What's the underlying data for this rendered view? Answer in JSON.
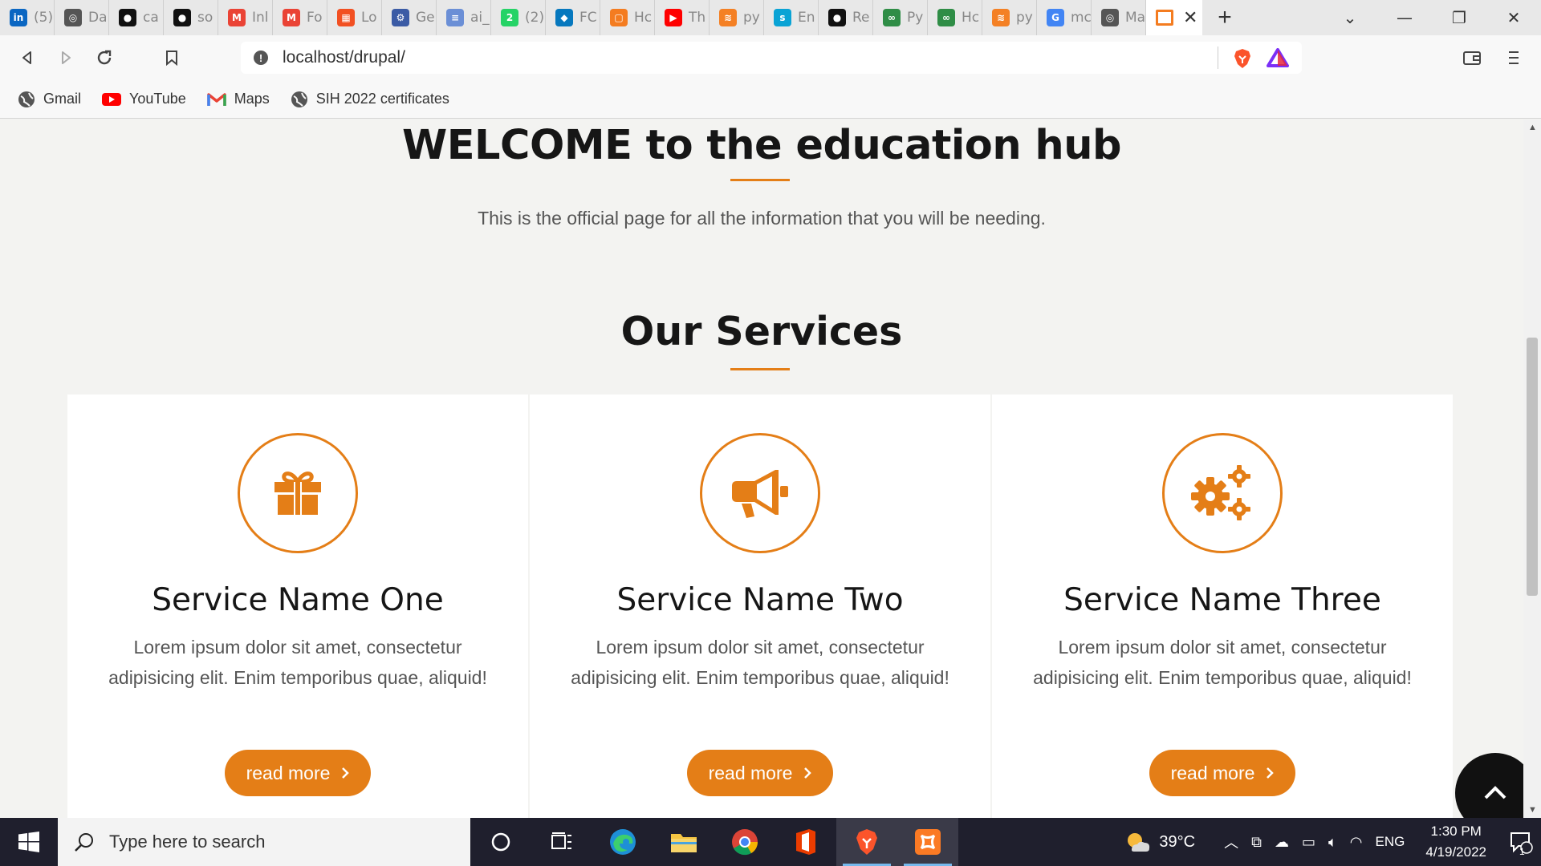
{
  "browser": {
    "tabs": [
      {
        "icon": "linkedin-icon",
        "title": "(5)",
        "color": "#0a66c2",
        "glyph": "in"
      },
      {
        "icon": "globe-icon",
        "title": "Da",
        "color": "#555555",
        "glyph": "◎"
      },
      {
        "icon": "github-icon",
        "title": "ca",
        "color": "#111111",
        "glyph": "●"
      },
      {
        "icon": "github-icon",
        "title": "so",
        "color": "#111111",
        "glyph": "●"
      },
      {
        "icon": "gmail-icon",
        "title": "Inl",
        "color": "#ea4335",
        "glyph": "M"
      },
      {
        "icon": "gmail-icon",
        "title": "Fo",
        "color": "#ea4335",
        "glyph": "M"
      },
      {
        "icon": "microsoft-icon",
        "title": "Lo",
        "color": "#f25022",
        "glyph": "▦"
      },
      {
        "icon": "settings-icon",
        "title": "Ge",
        "color": "#3b5ba5",
        "glyph": "⚙"
      },
      {
        "icon": "table-icon",
        "title": "ai_",
        "color": "#6b8fd6",
        "glyph": "≡"
      },
      {
        "icon": "whatsapp-icon",
        "title": "(2)",
        "color": "#25d366",
        "glyph": "2"
      },
      {
        "icon": "drupal-icon",
        "title": "FC",
        "color": "#0678be",
        "glyph": "◆"
      },
      {
        "icon": "page-icon",
        "title": "Hc",
        "color": "#f47c20",
        "glyph": "▢"
      },
      {
        "icon": "youtube-icon",
        "title": "Th",
        "color": "#ff0000",
        "glyph": "▶"
      },
      {
        "icon": "stackoverflow-icon",
        "title": "py",
        "color": "#f48024",
        "glyph": "≋"
      },
      {
        "icon": "spacy-icon",
        "title": "En",
        "color": "#09a3d5",
        "glyph": "s"
      },
      {
        "icon": "github-icon",
        "title": "Re",
        "color": "#111111",
        "glyph": "●"
      },
      {
        "icon": "gfg-icon",
        "title": "Py",
        "color": "#2f8d46",
        "glyph": "∞"
      },
      {
        "icon": "gfg-icon",
        "title": "Hc",
        "color": "#2f8d46",
        "glyph": "∞"
      },
      {
        "icon": "stackoverflow-icon",
        "title": "py",
        "color": "#f48024",
        "glyph": "≋"
      },
      {
        "icon": "google-icon",
        "title": "mc",
        "color": "#4285f4",
        "glyph": "G"
      },
      {
        "icon": "globe-icon",
        "title": "Ma",
        "color": "#555555",
        "glyph": "◎"
      }
    ],
    "active_tab_icon": "page-icon",
    "active_tab_color": "#f47c20",
    "new_tab_label": "+",
    "url": "localhost/drupal/",
    "bookmarks": [
      {
        "icon": "globe-icon",
        "label": "Gmail"
      },
      {
        "icon": "youtube-icon",
        "label": "YouTube"
      },
      {
        "icon": "gmail-icon",
        "label": "Maps"
      },
      {
        "icon": "globe-icon",
        "label": "SIH 2022 certificates"
      }
    ]
  },
  "page": {
    "welcome_title": "WELCOME to the education hub",
    "welcome_subtitle": "This is the official page for all the information that you will be needing.",
    "services_title": "Our Services",
    "accent_color": "#e47e17",
    "services": [
      {
        "icon": "gift-icon",
        "name": "Service Name One",
        "text": "Lorem ipsum dolor sit amet, consectetur adipisicing elit. Enim temporibus quae, aliquid!",
        "button": "read more"
      },
      {
        "icon": "megaphone-icon",
        "name": "Service Name Two",
        "text": "Lorem ipsum dolor sit amet, consectetur adipisicing elit. Enim temporibus quae, aliquid!",
        "button": "read more"
      },
      {
        "icon": "gears-icon",
        "name": "Service Name Three",
        "text": "Lorem ipsum dolor sit amet, consectetur adipisicing elit. Enim temporibus quae, aliquid!",
        "button": "read more"
      }
    ]
  },
  "taskbar": {
    "search_placeholder": "Type here to search",
    "temperature": "39°C",
    "language": "ENG",
    "time": "1:30 PM",
    "date": "4/19/2022",
    "notification_count": "1"
  }
}
